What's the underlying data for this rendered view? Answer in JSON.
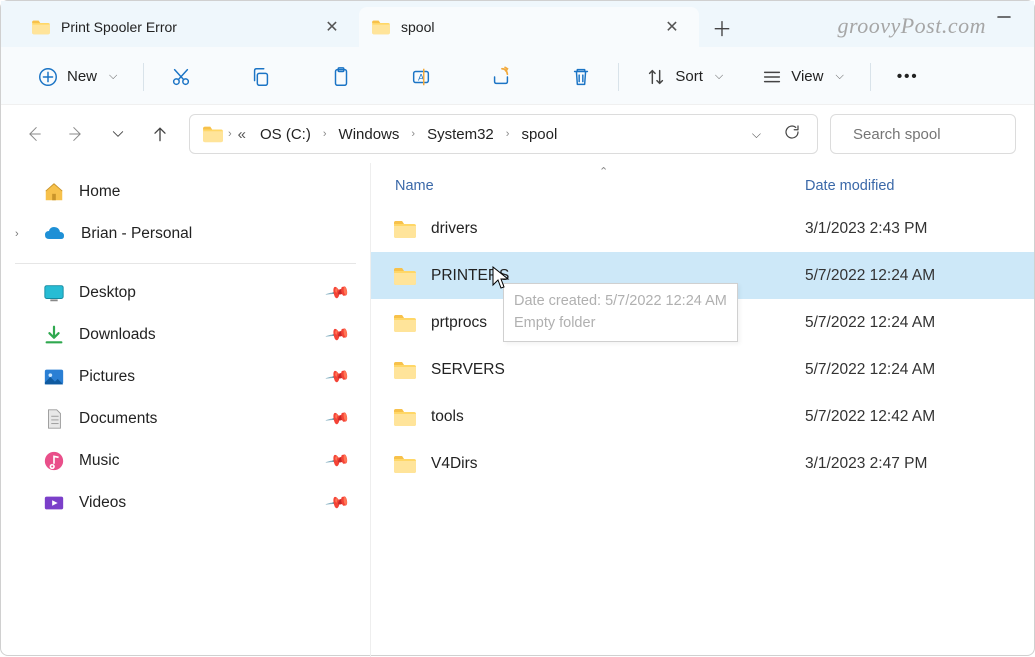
{
  "tabs": [
    {
      "label": "Print Spooler Error",
      "active": false
    },
    {
      "label": "spool",
      "active": true
    }
  ],
  "watermark": "groovyPost.com",
  "toolbar": {
    "new_label": "New",
    "sort_label": "Sort",
    "view_label": "View"
  },
  "breadcrumb": {
    "root_label": "OS (C:)",
    "parts": [
      "Windows",
      "System32",
      "spool"
    ]
  },
  "search": {
    "placeholder": "Search spool"
  },
  "nav": {
    "home": "Home",
    "personal": "Brian - Personal",
    "quick": [
      {
        "label": "Desktop"
      },
      {
        "label": "Downloads"
      },
      {
        "label": "Pictures"
      },
      {
        "label": "Documents"
      },
      {
        "label": "Music"
      },
      {
        "label": "Videos"
      }
    ]
  },
  "columns": {
    "name": "Name",
    "date": "Date modified"
  },
  "rows": [
    {
      "name": "drivers",
      "date": "3/1/2023 2:43 PM",
      "selected": false
    },
    {
      "name": "PRINTERS",
      "date": "5/7/2022 12:24 AM",
      "selected": true
    },
    {
      "name": "prtprocs",
      "date": "5/7/2022 12:24 AM",
      "selected": false
    },
    {
      "name": "SERVERS",
      "date": "5/7/2022 12:24 AM",
      "selected": false
    },
    {
      "name": "tools",
      "date": "5/7/2022 12:42 AM",
      "selected": false
    },
    {
      "name": "V4Dirs",
      "date": "3/1/2023 2:47 PM",
      "selected": false
    }
  ],
  "tooltip": {
    "line1": "Date created: 5/7/2022 12:24 AM",
    "line2": "Empty folder"
  }
}
